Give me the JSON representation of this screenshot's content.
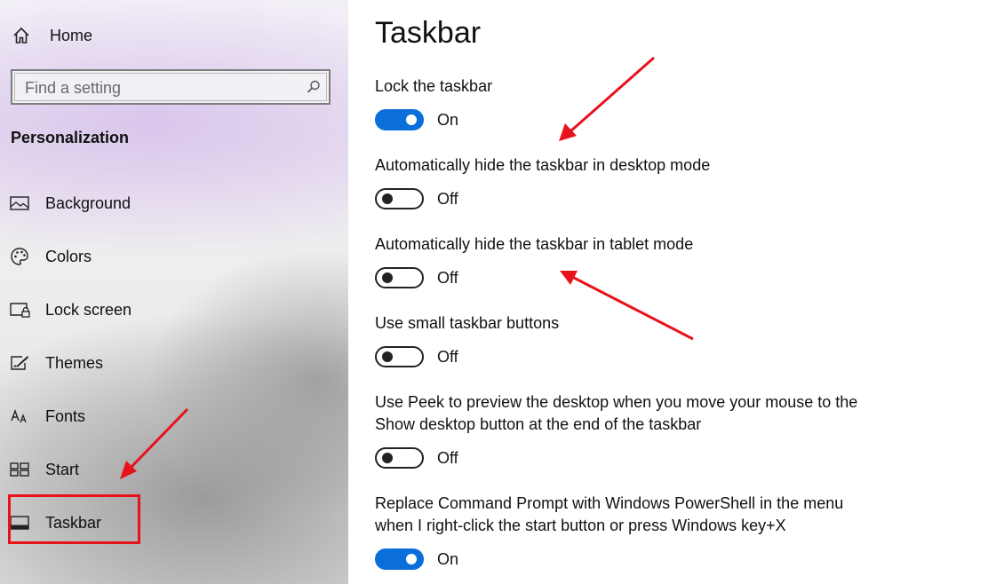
{
  "sidebar": {
    "home_label": "Home",
    "search_placeholder": "Find a setting",
    "section_title": "Personalization",
    "items": [
      {
        "label": "Background",
        "icon": "picture-icon"
      },
      {
        "label": "Colors",
        "icon": "palette-icon"
      },
      {
        "label": "Lock screen",
        "icon": "lock-screen-icon"
      },
      {
        "label": "Themes",
        "icon": "brush-icon"
      },
      {
        "label": "Fonts",
        "icon": "fonts-icon"
      },
      {
        "label": "Start",
        "icon": "start-icon"
      },
      {
        "label": "Taskbar",
        "icon": "taskbar-icon"
      }
    ],
    "selected": "Taskbar"
  },
  "main": {
    "title": "Taskbar",
    "settings": [
      {
        "label": "Lock the taskbar",
        "state": "On",
        "on": true
      },
      {
        "label": "Automatically hide the taskbar in desktop mode",
        "state": "Off",
        "on": false
      },
      {
        "label": "Automatically hide the taskbar in tablet mode",
        "state": "Off",
        "on": false
      },
      {
        "label": "Use small taskbar buttons",
        "state": "Off",
        "on": false
      },
      {
        "label": "Use Peek to preview the desktop when you move your mouse to the Show desktop button at the end of the taskbar",
        "state": "Off",
        "on": false
      },
      {
        "label": "Replace Command Prompt with Windows PowerShell in the menu when I right-click the start button or press Windows key+X",
        "state": "On",
        "on": true
      }
    ]
  },
  "colors": {
    "accent": "#0a6fd8",
    "annotation_red": "#e8121c"
  }
}
